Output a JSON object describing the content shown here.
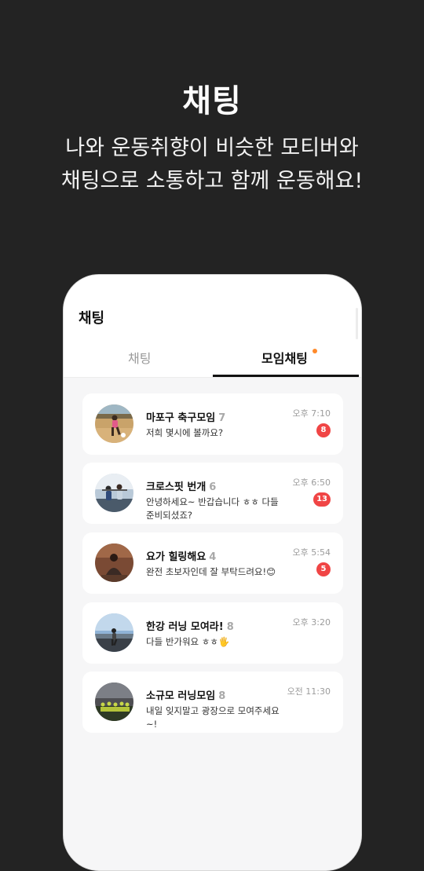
{
  "promo": {
    "title": "채팅",
    "subtitle_line1": "나와 운동취향이 비슷한 모티버와",
    "subtitle_line2": "채팅으로 소통하고 함께 운동해요!"
  },
  "app": {
    "header_title": "채팅",
    "tabs": [
      {
        "label": "채팅",
        "active": false
      },
      {
        "label": "모임채팅",
        "active": true,
        "has_new_dot": true
      }
    ],
    "accent_dot_color": "#ff8a2a",
    "badge_color": "#f04545"
  },
  "chat_rooms": [
    {
      "name": "마포구 축구모임",
      "members": "7",
      "message": "저희 몇시에 볼까요?",
      "time": "오후 7:10",
      "unread": "8",
      "avatar": "soccer-photo"
    },
    {
      "name": "크로스핏 번개",
      "members": "6",
      "message": "안녕하세요~ 반갑습니다 ㅎㅎ 다들 준비되셨죠?",
      "time": "오후 6:50",
      "unread": "13",
      "avatar": "crossfit-photo"
    },
    {
      "name": "요가 힐링해요",
      "members": "4",
      "message": "완전 초보자인데 잘 부탁드려요!😊",
      "time": "오후 5:54",
      "unread": "5",
      "avatar": "yoga-photo"
    },
    {
      "name": "한강 러닝 모여라!",
      "members": "8",
      "message": "다들 반가워요 ㅎㅎ🖐",
      "time": "오후 3:20",
      "unread": "",
      "avatar": "running-photo"
    },
    {
      "name": "소규모 러닝모임",
      "members": "8",
      "message": "내일 잊지말고 광장으로 모여주세요~!",
      "time": "오전 11:30",
      "unread": "",
      "avatar": "group-running-photo"
    }
  ]
}
